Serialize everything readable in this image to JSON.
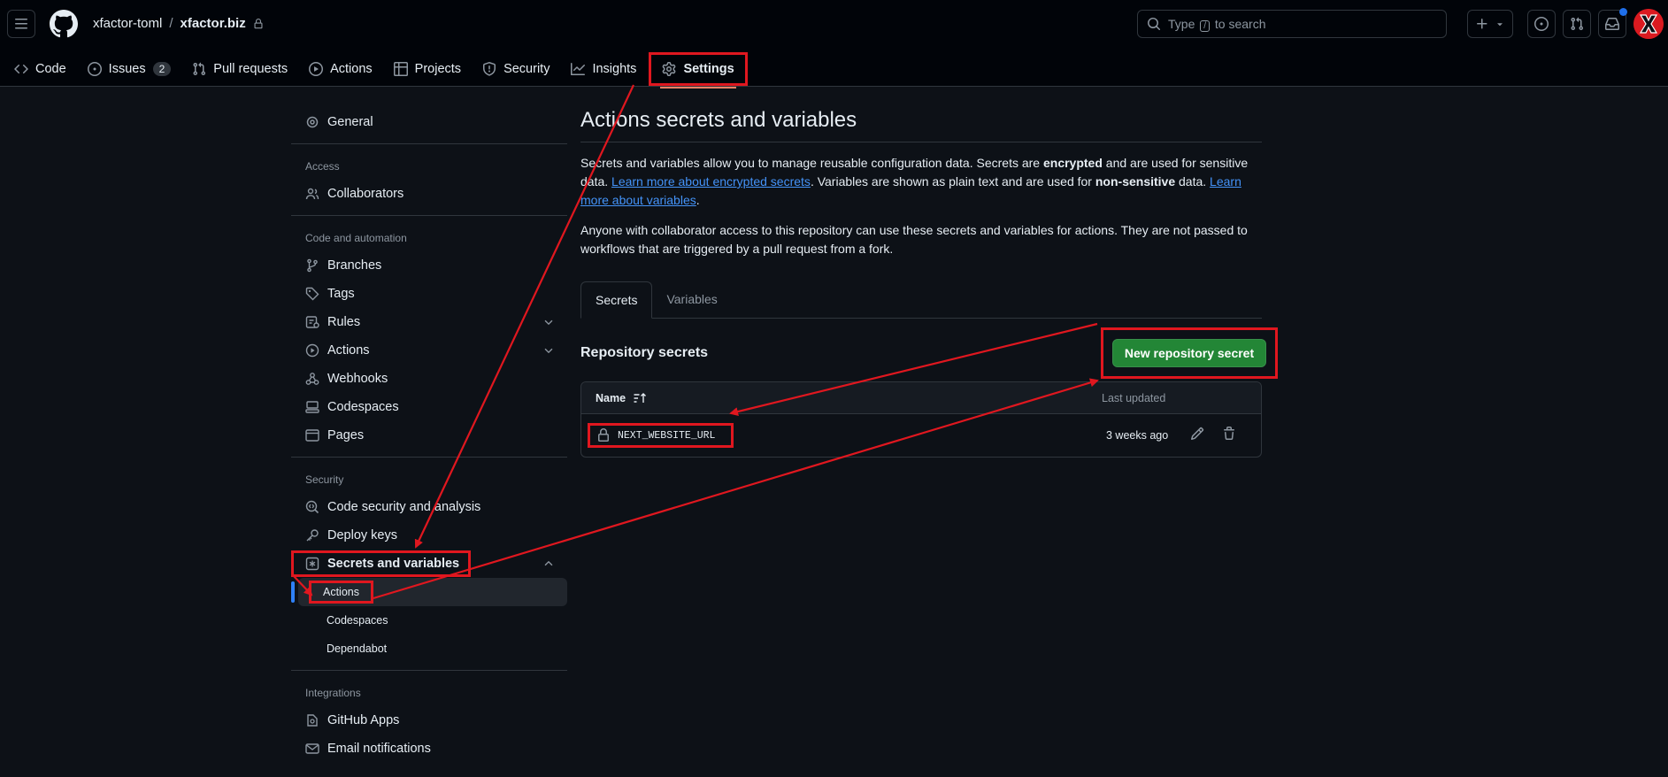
{
  "header": {
    "owner": "xfactor-toml",
    "separator": "/",
    "repo": "xfactor.biz",
    "search_placeholder_pre": "Type",
    "search_key": "/",
    "search_placeholder_post": "to search"
  },
  "repo_nav": [
    {
      "label": "Code",
      "icon": "code-icon"
    },
    {
      "label": "Issues",
      "icon": "issue-opened-icon",
      "count": "2"
    },
    {
      "label": "Pull requests",
      "icon": "git-pull-request-icon"
    },
    {
      "label": "Actions",
      "icon": "play-icon"
    },
    {
      "label": "Projects",
      "icon": "table-icon"
    },
    {
      "label": "Security",
      "icon": "shield-icon"
    },
    {
      "label": "Insights",
      "icon": "graph-icon"
    },
    {
      "label": "Settings",
      "icon": "gear-icon",
      "active": true
    }
  ],
  "sidebar": {
    "general": "General",
    "access_heading": "Access",
    "collaborators": "Collaborators",
    "code_heading": "Code and automation",
    "branches": "Branches",
    "tags": "Tags",
    "rules": "Rules",
    "actions": "Actions",
    "webhooks": "Webhooks",
    "codespaces": "Codespaces",
    "pages": "Pages",
    "security_heading": "Security",
    "code_security": "Code security and analysis",
    "deploy_keys": "Deploy keys",
    "secrets_vars": "Secrets and variables",
    "sub_actions": "Actions",
    "sub_codespaces": "Codespaces",
    "sub_dependabot": "Dependabot",
    "integrations_heading": "Integrations",
    "github_apps": "GitHub Apps",
    "email_notifications": "Email notifications"
  },
  "main": {
    "title": "Actions secrets and variables",
    "p1_a": "Secrets and variables allow you to manage reusable configuration data. Secrets are ",
    "p1_b": "encrypted",
    "p1_c": " and are used for sensitive data. ",
    "p1_link1": "Learn more about encrypted secrets",
    "p1_d": ". Variables are shown as plain text and are used for ",
    "p1_e": "non-sensitive",
    "p1_f": " data. ",
    "p1_link2": "Learn more about variables",
    "p1_g": ".",
    "p2": "Anyone with collaborator access to this repository can use these secrets and variables for actions. They are not passed to workflows that are triggered by a pull request from a fork.",
    "tab_secrets": "Secrets",
    "tab_variables": "Variables",
    "section_title": "Repository secrets",
    "new_secret_button": "New repository secret",
    "col_name": "Name",
    "col_updated": "Last updated",
    "rows": [
      {
        "name": "NEXT_WEBSITE_URL",
        "updated": "3 weeks ago"
      }
    ]
  },
  "colors": {
    "background": "#0d1117",
    "annotation": "#e0171f",
    "primary_button": "#238636",
    "link": "#4493f8"
  }
}
